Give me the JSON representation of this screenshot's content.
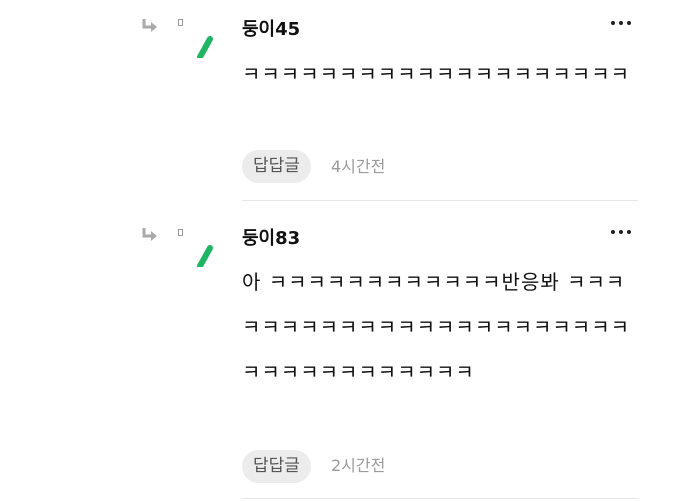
{
  "comments": [
    {
      "nickname": "둥이45",
      "text": "ㅋㅋㅋㅋㅋㅋㅋㅋㅋㅋㅋㅋㅋㅋㅋㅋㅋㅋㅋㅋ",
      "reply_label": "답답글",
      "time": "4시간전"
    },
    {
      "nickname": "둥이83",
      "text": "아 ㅋㅋㅋㅋㅋㅋㅋㅋㅋㅋㅋㅋ반응봐 ㅋㅋㅋㅋㅋㅋㅋㅋㅋㅋㅋㅋㅋㅋㅋㅋㅋㅋㅋㅋㅋㅋㅋㅋㅋㅋㅋㅋㅋㅋㅋㅋㅋㅋㅋ",
      "reply_label": "답답글",
      "time": "2시간전"
    }
  ],
  "icons": {
    "reply": "reply-arrow-icon",
    "image": "image-placeholder-icon",
    "pen": "green-pen-icon",
    "more": "more-dots-icon"
  },
  "colors": {
    "pen": "#1fb562",
    "reply_button_bg": "#ececec",
    "time": "#9b9b9b"
  }
}
